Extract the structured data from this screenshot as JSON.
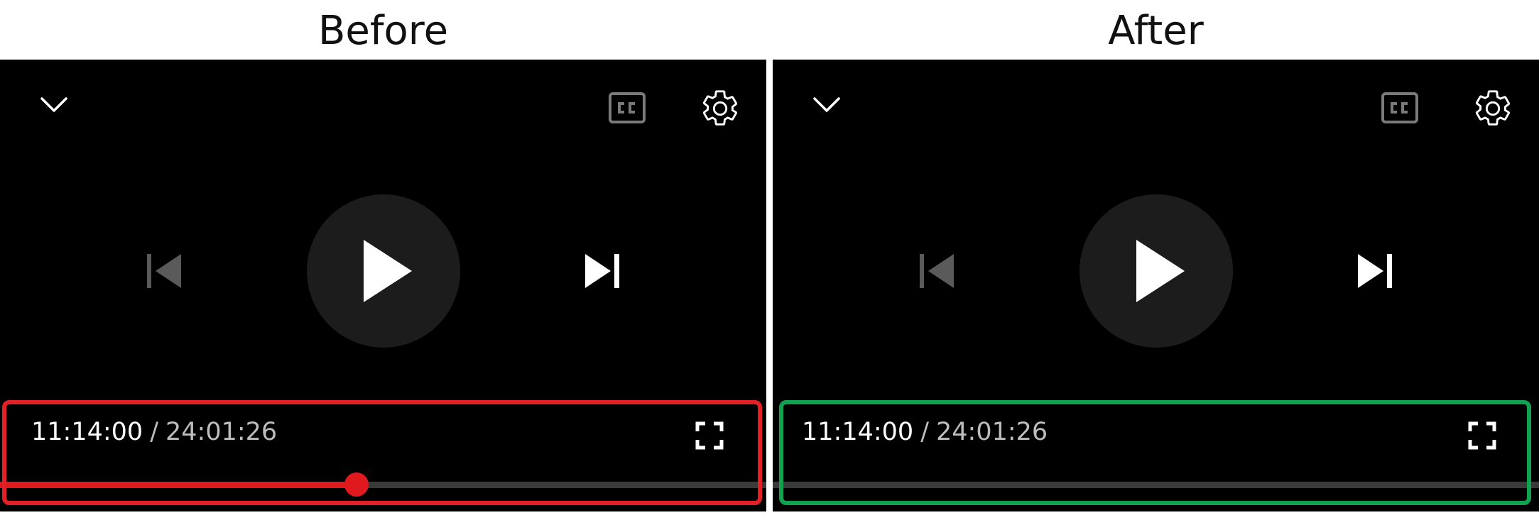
{
  "labels": {
    "before": "Before",
    "after": "After"
  },
  "before": {
    "current_time": "11:14:00",
    "separator": "/",
    "duration": "24:01:26",
    "progress_fraction": 0.465,
    "progress_color": "#e0191f",
    "highlight_color": "#e32026"
  },
  "after": {
    "current_time": "11:14:00",
    "separator": "/",
    "duration": "24:01:26",
    "progress_fraction": 0,
    "highlight_color": "#12a150"
  },
  "icons": {
    "collapse": "chevron-down-icon",
    "captions": "closed-captions-icon",
    "settings": "gear-icon",
    "previous": "skip-previous-icon",
    "play": "play-icon",
    "next": "skip-next-icon",
    "fullscreen": "fullscreen-icon"
  }
}
